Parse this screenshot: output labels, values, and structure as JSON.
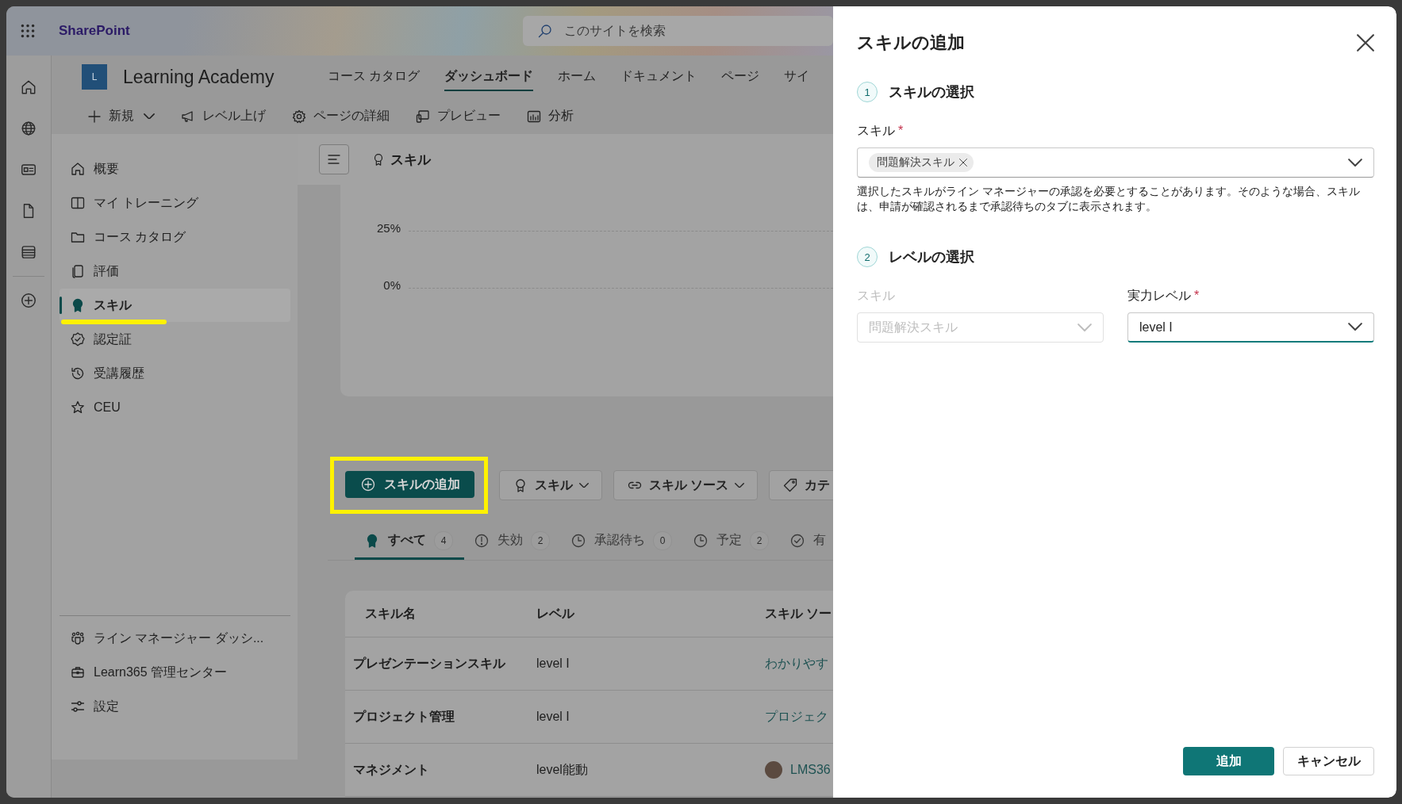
{
  "app_bar": {
    "brand": "SharePoint",
    "search": {
      "placeholder": "このサイトを検索"
    }
  },
  "site": {
    "logo": "L",
    "title": "Learning Academy",
    "nav": [
      {
        "label": "コース カタログ",
        "selected": false
      },
      {
        "label": "ダッシュボード",
        "selected": true
      },
      {
        "label": "ホーム",
        "selected": false
      },
      {
        "label": "ドキュメント",
        "selected": false
      },
      {
        "label": "ページ",
        "selected": false
      },
      {
        "label": "サイ",
        "selected": false
      }
    ]
  },
  "command_bar": [
    {
      "label": "新規",
      "dropdown": true
    },
    {
      "label": "レベル上げ",
      "dropdown": false
    },
    {
      "label": "ページの詳細",
      "dropdown": false
    },
    {
      "label": "プレビュー",
      "dropdown": false
    },
    {
      "label": "分析",
      "dropdown": false
    }
  ],
  "nav": {
    "items": [
      {
        "label": "概要",
        "selected": false
      },
      {
        "label": "マイ トレーニング",
        "selected": false
      },
      {
        "label": "コース カタログ",
        "selected": false
      },
      {
        "label": "評価",
        "selected": false
      },
      {
        "label": "スキル",
        "selected": true
      },
      {
        "label": "認定証",
        "selected": false
      },
      {
        "label": "受講履歴",
        "selected": false
      },
      {
        "label": "CEU",
        "selected": false
      }
    ],
    "footer": [
      {
        "label": "ライン マネージャー ダッシ..."
      },
      {
        "label": "Learn365 管理センター"
      },
      {
        "label": "設定"
      }
    ]
  },
  "page_header": {
    "title": "スキル"
  },
  "chart": {
    "ticks": [
      "25%",
      "0%"
    ]
  },
  "toolbar": {
    "add_button": "スキルの追加",
    "filters": [
      {
        "label": "スキル",
        "dropdown": true
      },
      {
        "label": "スキル ソース",
        "dropdown": true
      },
      {
        "label": "カテ",
        "dropdown": false
      }
    ]
  },
  "tabs": [
    {
      "label": "すべて",
      "count": "4",
      "selected": true
    },
    {
      "label": "失効",
      "count": "2",
      "selected": false
    },
    {
      "label": "承認待ち",
      "count": "0",
      "selected": false
    },
    {
      "label": "予定",
      "count": "2",
      "selected": false
    },
    {
      "label": "有",
      "selected": false
    }
  ],
  "table": {
    "columns": [
      "スキル名",
      "レベル",
      "スキル ソー"
    ],
    "rows": [
      {
        "name": "プレゼンテーションスキル",
        "level": "level I",
        "source": "わかりやす",
        "avatar": false
      },
      {
        "name": "プロジェクト管理",
        "level": "level I",
        "source": "プロジェク",
        "avatar": false
      },
      {
        "name": "マネジメント",
        "level": "level能動",
        "source": "LMS36",
        "avatar": true
      }
    ]
  },
  "panel": {
    "title": "スキルの追加",
    "steps": [
      {
        "number": "1",
        "title": "スキルの選択"
      },
      {
        "number": "2",
        "title": "レベルの選択"
      }
    ],
    "skill_field": {
      "label": "スキル",
      "required_mark": "*",
      "tags": [
        "問題解決スキル"
      ]
    },
    "help": "選択したスキルがライン マネージャーの承認を必要とすることがあります。そのような場合、スキルは、申請が確認されるまで承認待ちのタブに表示されます。",
    "level_fields": [
      {
        "label": "スキル",
        "value": "問題解決スキル",
        "disabled": true,
        "focused": false
      },
      {
        "label": "実力レベル",
        "required_mark": "*",
        "value": "level I",
        "disabled": false,
        "focused": true
      }
    ],
    "buttons": [
      {
        "label": "追加",
        "kind": "primary"
      },
      {
        "label": "キャンセル",
        "kind": "secondary"
      }
    ]
  }
}
